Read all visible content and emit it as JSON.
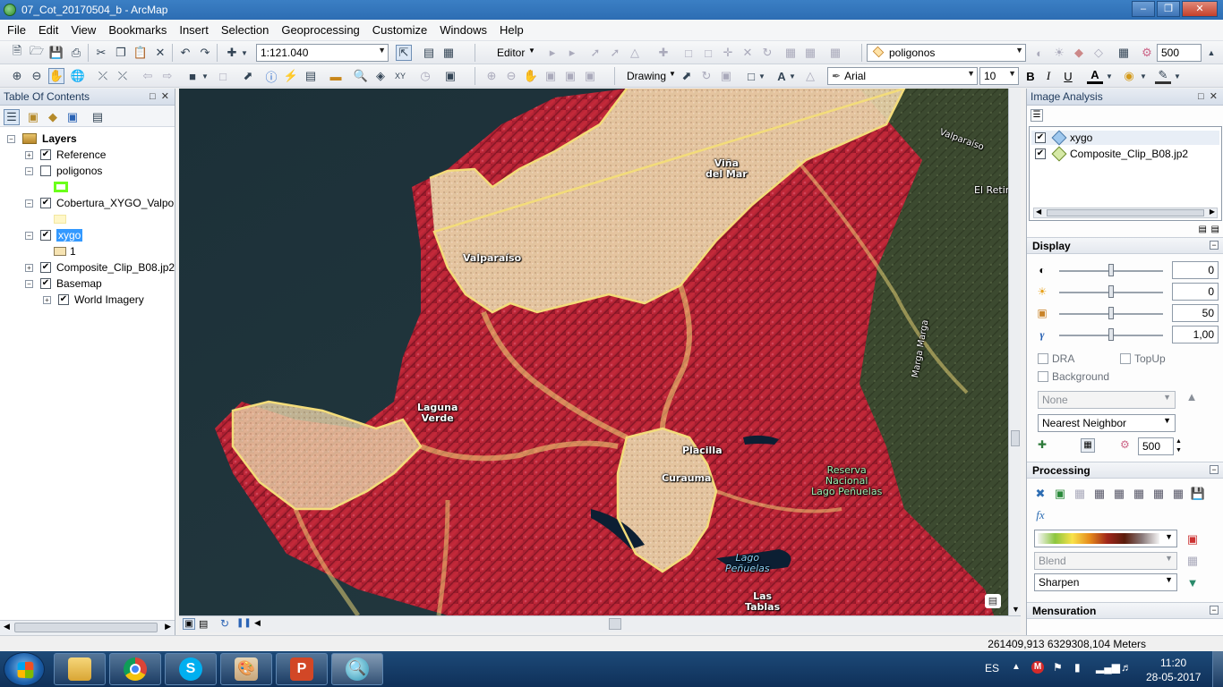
{
  "window": {
    "title": "07_Cot_20170504_b - ArcMap"
  },
  "menus": [
    "File",
    "Edit",
    "View",
    "Bookmarks",
    "Insert",
    "Selection",
    "Geoprocessing",
    "Customize",
    "Windows",
    "Help"
  ],
  "toolbar": {
    "scale": "1:121.040",
    "editor_label": "Editor",
    "layer_combo": "poligonos",
    "resolution_value": "500",
    "drawing_label": "Drawing",
    "font_name": "Arial",
    "font_size": "10",
    "bold": "B",
    "italic": "I",
    "underline": "U",
    "font_color_letter": "A"
  },
  "toc": {
    "title": "Table Of Contents",
    "root_label": "Layers",
    "layers": [
      {
        "name": "Reference",
        "checked": true,
        "expand": "+"
      },
      {
        "name": "poligonos",
        "checked": false,
        "expand": "−"
      },
      {
        "name": "Cobertura_XYGO_Valpo",
        "checked": true,
        "expand": "−"
      },
      {
        "name": "xygo",
        "checked": true,
        "expand": "−",
        "selected": true
      },
      {
        "name": "Composite_Clip_B08.jp2",
        "checked": true,
        "expand": "+"
      },
      {
        "name": "Basemap",
        "checked": true,
        "expand": "−"
      },
      {
        "name": "World Imagery",
        "checked": true,
        "expand": "+"
      }
    ],
    "xygo_class_value": "1",
    "poligonos_swatch_color": "#6bff1a",
    "cobertura_swatch_color": "#fff7c8",
    "xygo_swatch_color": "#f6e3b2"
  },
  "map": {
    "labels": {
      "vina_del_mar": "Viña\ndel Mar",
      "valparaiso": "Valparaíso",
      "laguna_verde": "Laguna\nVerde",
      "placilla": "Placilla",
      "curauma": "Curauma",
      "reserva": "Reserva\nNacional\nLago Peñuelas",
      "lago_penuelas": "Lago\nPeñuelas",
      "las_tablas": "Las\nTablas",
      "el_retiro": "El Retiro",
      "valparaiso_road": "Valparaíso",
      "marga_marga": "Marga Marga"
    }
  },
  "image_analysis": {
    "title": "Image Analysis",
    "layers": [
      {
        "name": "xygo",
        "checked": true
      },
      {
        "name": "Composite_Clip_B08.jp2",
        "checked": true
      }
    ],
    "display": {
      "title": "Display",
      "contrast": "0",
      "brightness": "0",
      "transparency": "50",
      "gamma": "1,00",
      "dra_label": "DRA",
      "topup_label": "TopUp",
      "background_label": "Background",
      "stretch_value": "None",
      "resampling_value": "Nearest Neighbor",
      "resolution_value": "500"
    },
    "processing": {
      "title": "Processing",
      "blend_value": "Blend",
      "sharpen_value": "Sharpen"
    },
    "mensuration": {
      "title": "Mensuration"
    }
  },
  "statusbar": {
    "coordinates": "261409,913  6329308,104 Meters"
  },
  "taskbar": {
    "language": "ES",
    "time": "11:20",
    "date": "28-05-2017"
  }
}
